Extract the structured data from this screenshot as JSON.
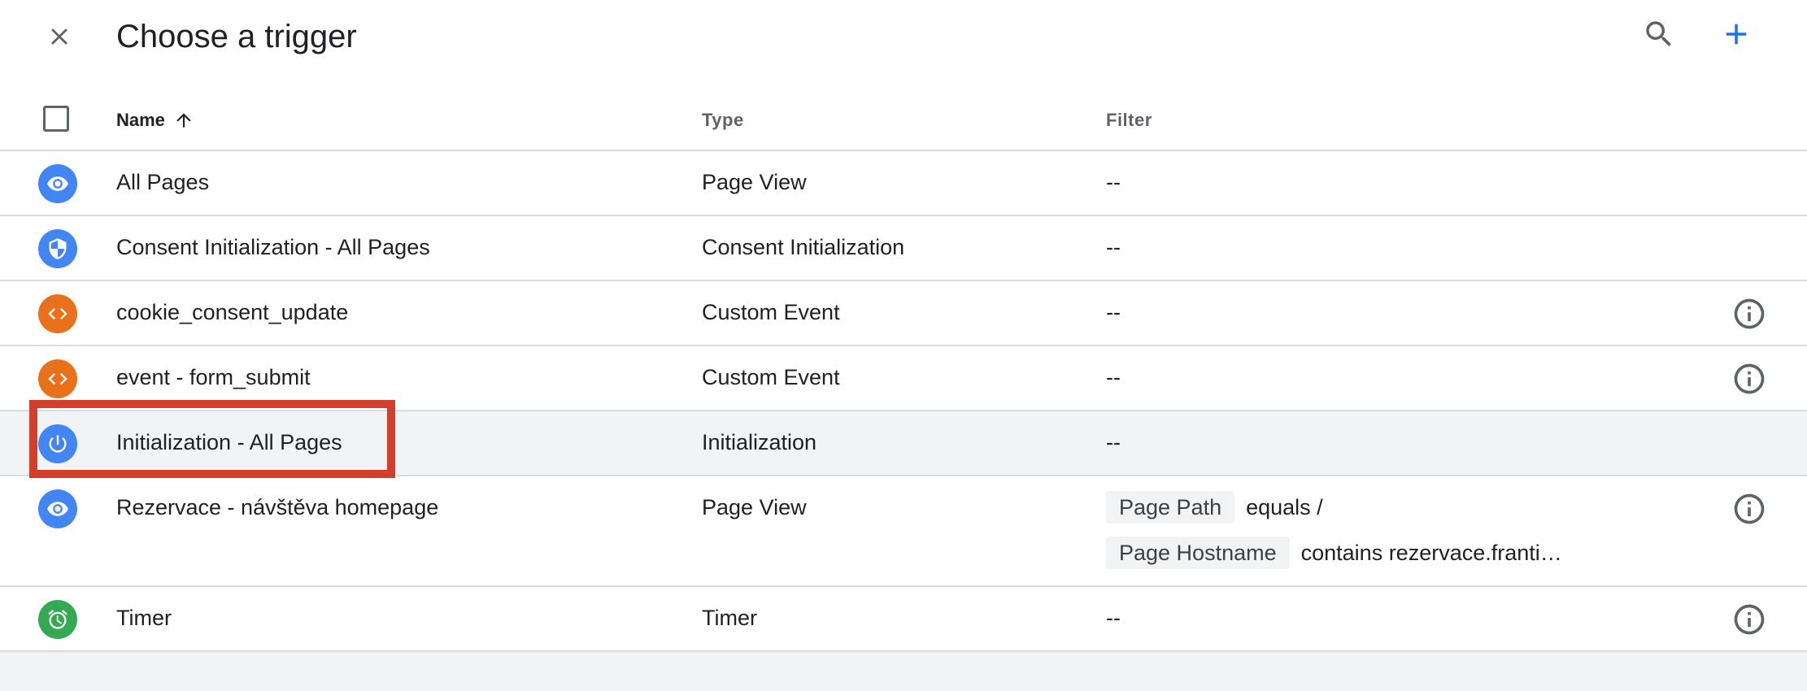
{
  "header": {
    "title": "Choose a trigger",
    "close_icon": "close-icon",
    "search_icon": "search-icon",
    "add_icon": "add-icon"
  },
  "columns": {
    "name": "Name",
    "type": "Type",
    "filter": "Filter",
    "sort_icon": "arrow-up-icon"
  },
  "colors": {
    "pageview": "#4285f4",
    "consent": "#4285f4",
    "custom_event": "#e8711a",
    "initialization": "#4285f4",
    "timer": "#34a853",
    "accent": "#1a73e8",
    "highlight": "#d23f2a"
  },
  "triggers": [
    {
      "name": "All Pages",
      "type": "Page View",
      "filter": "--",
      "icon": "eye-icon",
      "info": false
    },
    {
      "name": "Consent Initialization - All Pages",
      "type": "Consent Initialization",
      "filter": "--",
      "icon": "shield-icon",
      "info": false
    },
    {
      "name": "cookie_consent_update",
      "type": "Custom Event",
      "filter": "--",
      "icon": "code-icon",
      "info": true
    },
    {
      "name": "event - form_submit",
      "type": "Custom Event",
      "filter": "--",
      "icon": "code-icon",
      "info": true
    },
    {
      "name": "Initialization - All Pages",
      "type": "Initialization",
      "filter": "--",
      "icon": "power-icon",
      "info": false,
      "selected": true
    },
    {
      "name": "Rezervace - návštěva homepage",
      "type": "Page View",
      "icon": "eye-icon",
      "info": true,
      "filters": [
        {
          "variable": "Page Path",
          "condition": "equals /"
        },
        {
          "variable": "Page Hostname",
          "condition": "contains rezervace.franti…"
        }
      ]
    },
    {
      "name": "Timer",
      "type": "Timer",
      "filter": "--",
      "icon": "alarm-icon",
      "info": true
    }
  ]
}
